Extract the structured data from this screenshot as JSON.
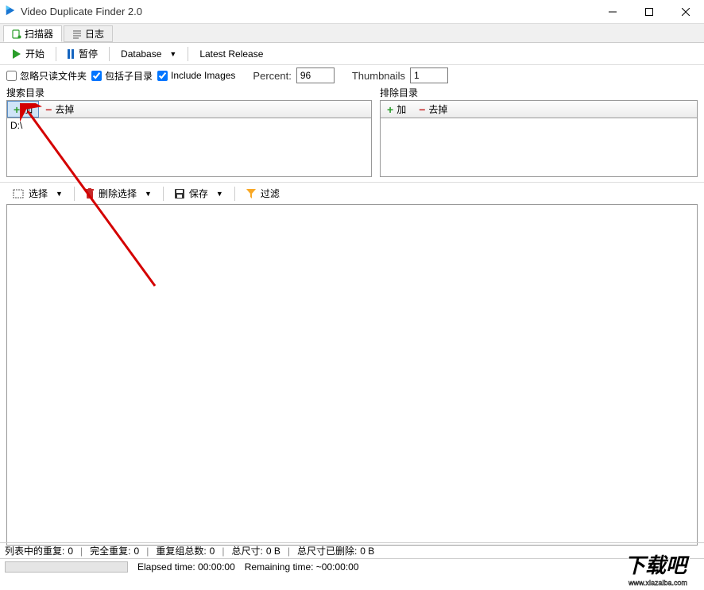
{
  "titlebar": {
    "title": "Video Duplicate Finder 2.0"
  },
  "tabs": {
    "scanner": "扫描器",
    "log": "日志"
  },
  "toolbar": {
    "start": "开始",
    "pause": "暂停",
    "database": "Database",
    "latest_release": "Latest Release"
  },
  "options": {
    "ignore_readonly": "忽略只读文件夹",
    "include_subdirs": "包括子目录",
    "include_images": "Include Images",
    "percent_label": "Percent:",
    "percent_value": "96",
    "thumbnails_label": "Thumbnails",
    "thumbnails_value": "1"
  },
  "search_dirs": {
    "title": "搜索目录",
    "add": "加",
    "remove": "去掉",
    "items": [
      "D:\\"
    ]
  },
  "exclude_dirs": {
    "title": "排除目录",
    "add": "加",
    "remove": "去掉"
  },
  "results_toolbar": {
    "select": "选择",
    "delete_selected": "删除选择",
    "save": "保存",
    "filter": "过滤"
  },
  "status": {
    "duplicates_label": "列表中的重复:",
    "duplicates_value": "0",
    "complete_label": "完全重复:",
    "complete_value": "0",
    "groups_label": "重复组总数:",
    "groups_value": "0",
    "size_label": "总尺寸:",
    "size_value": "0 B",
    "deleted_label": "总尺寸已删除:",
    "deleted_value": "0 B",
    "elapsed": "Elapsed time: 00:00:00",
    "remaining": "Remaining time: ~00:00:00"
  },
  "watermark": {
    "text": "下载吧",
    "url": "www.xiazaiba.com"
  }
}
